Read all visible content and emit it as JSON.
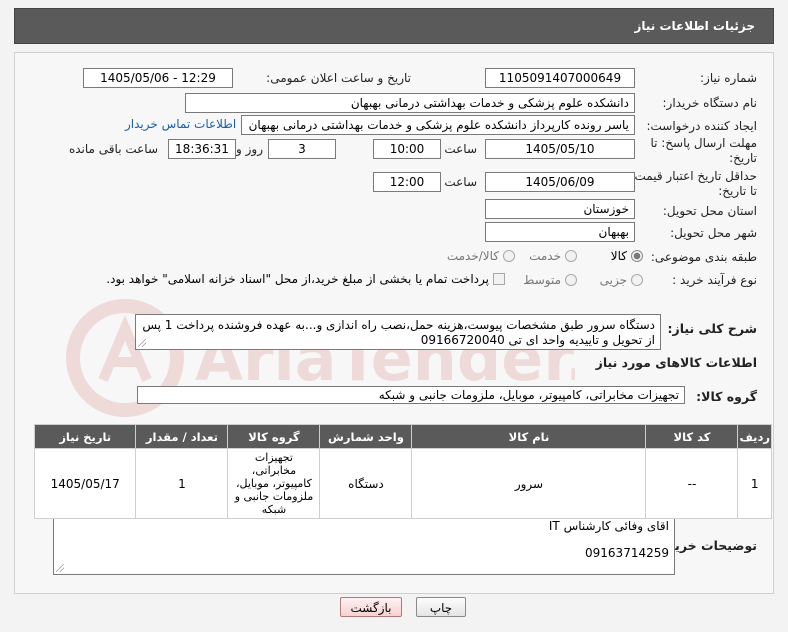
{
  "header": {
    "title": "جزئیات اطلاعات نیاز"
  },
  "form": {
    "need_number_label": "شماره نیاز:",
    "need_number_value": "1105091407000649",
    "announce_label": "تاریخ و ساعت اعلان عمومی:",
    "announce_value": "1405/05/06 - 12:29",
    "buyer_org_label": "نام دستگاه خریدار:",
    "buyer_org_value": "دانشکده علوم پزشکی و خدمات بهداشتی  درمانی بهبهان",
    "requester_label": "ایجاد کننده درخواست:",
    "requester_value": "یاسر رونده کارپرداز دانشکده علوم پزشکی و خدمات بهداشتی  درمانی بهبهان",
    "buyer_contact_link": "اطلاعات تماس خریدار",
    "deadline_label_1": "مهلت ارسال پاسخ: تا",
    "deadline_label_2": "تاریخ:",
    "deadline_date": "1405/05/10",
    "time_word": "ساعت",
    "deadline_time": "10:00",
    "days_value": "3",
    "days_word": "روز و",
    "remaining_time": "18:36:31",
    "remaining_word": "ساعت باقی مانده",
    "price_validity_label_1": "حداقل تاریخ اعتبار قیمت:",
    "price_validity_label_2": "تا تاریخ:",
    "price_validity_date": "1405/06/09",
    "price_validity_time": "12:00",
    "province_label": "استان محل تحویل:",
    "province_value": "خوزستان",
    "city_label": "شهر محل تحویل:",
    "city_value": "بهبهان",
    "category_label": "طبقه بندی موضوعی:",
    "category_options": [
      "کالا",
      "خدمت",
      "کالا/خدمت"
    ],
    "category_selected": "کالا",
    "process_label": "نوع فرآیند خرید :",
    "process_options": [
      "جزیی",
      "متوسط"
    ],
    "payment_note": "پرداخت تمام یا بخشی از مبلغ خرید،از محل \"اسناد خزانه اسلامی\" خواهد بود."
  },
  "description": {
    "label": "شرح کلی نیاز:",
    "text": "دستگاه سرور  طبق مشخصات پیوست،هزینه حمل،نصب راه اندازی و...به عهده فروشنده پرداخت 1 پس از تحویل و تاییدیه واحد ای تی 09166720040"
  },
  "goods_info_title": "اطلاعات کالاهای مورد نیاز",
  "goods_group": {
    "label": "گروه کالا:",
    "value": "تجهیزات مخابراتی، کامپیوتر، موبایل، ملزومات جانبی و شبکه"
  },
  "table": {
    "headers": [
      "ردیف",
      "کد کالا",
      "نام کالا",
      "واحد شمارش",
      "گروه کالا",
      "تعداد / مقدار",
      "تاریخ نیاز"
    ],
    "rows": [
      [
        "1",
        "--",
        "سرور",
        "دستگاه",
        "تجهیزات مخابراتی، کامپیوتر، موبایل، ملزومات جانبی و شبکه",
        "1",
        "1405/05/17"
      ]
    ]
  },
  "buyer_notes": {
    "label": "توضیحات خریدار:",
    "line1": "اقای وفائی کارشناس IT",
    "line2": "09163714259"
  },
  "buttons": {
    "print": "چاپ",
    "back": "بازگشت"
  },
  "watermark_text": "AriaTender.net"
}
